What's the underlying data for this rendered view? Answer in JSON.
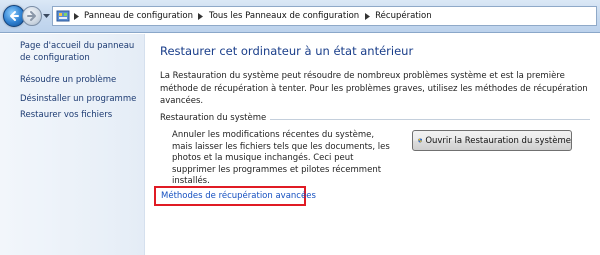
{
  "address_bar": {
    "breadcrumbs": [
      "Panneau de configuration",
      "Tous les Panneaux de configuration",
      "Récupération"
    ]
  },
  "left_pane": {
    "links": [
      "Page d'accueil du panneau de configuration",
      "Résoudre un problème",
      "Désinstaller un programme",
      "Restaurer vos fichiers"
    ]
  },
  "main": {
    "title": "Restaurer cet ordinateur à un état antérieur",
    "intro": "La Restauration du système peut résoudre de nombreux problèmes système et est la première méthode de récupération à tenter. Pour les problèmes graves, utilisez les méthodes de récupération avancées.",
    "section_title": "Restauration du système",
    "section_desc": "Annuler les modifications récentes du système, mais laisser les fichiers tels que les documents, les photos et la musique inchangés. Ceci peut supprimer les programmes et pilotes récemment installés.",
    "restore_button": "Ouvrir la Restauration du système",
    "advanced_link": "Méthodes de récupération avancées"
  },
  "colors": {
    "title": "#1a3e8a",
    "link": "#1550c0",
    "highlight_box": "#e01b24"
  },
  "icons": [
    "back-arrow-icon",
    "forward-arrow-icon",
    "history-dropdown-icon",
    "control-panel-icon",
    "breadcrumb-chevron-icon",
    "uac-shield-icon"
  ]
}
